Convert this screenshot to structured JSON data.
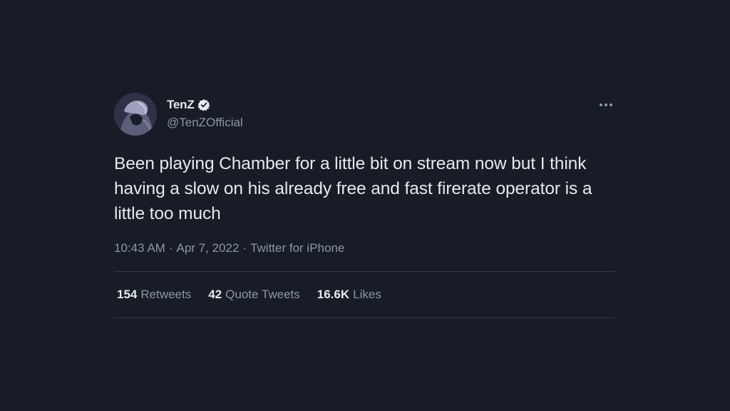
{
  "tweet": {
    "author": {
      "display_name": "TenZ",
      "handle": "@TenZOfficial",
      "verified_icon": "verified-badge-icon",
      "avatar": "avatar"
    },
    "more_icon": "more-options-icon",
    "text": "Been playing Chamber for a little bit on stream now but I think having a slow on his already free and fast firerate operator is a little too much",
    "time": "10:43 AM",
    "separator": "·",
    "date": "Apr 7, 2022",
    "source": "Twitter for iPhone",
    "stats": {
      "retweets": {
        "count": "154",
        "label": "Retweets"
      },
      "quote_tweets": {
        "count": "42",
        "label": "Quote Tweets"
      },
      "likes": {
        "count": "16.6K",
        "label": "Likes"
      }
    }
  },
  "colors": {
    "background": "#171c26",
    "text_primary": "#e7e9ea",
    "text_secondary": "#8b98a5",
    "divider": "#333a45"
  }
}
